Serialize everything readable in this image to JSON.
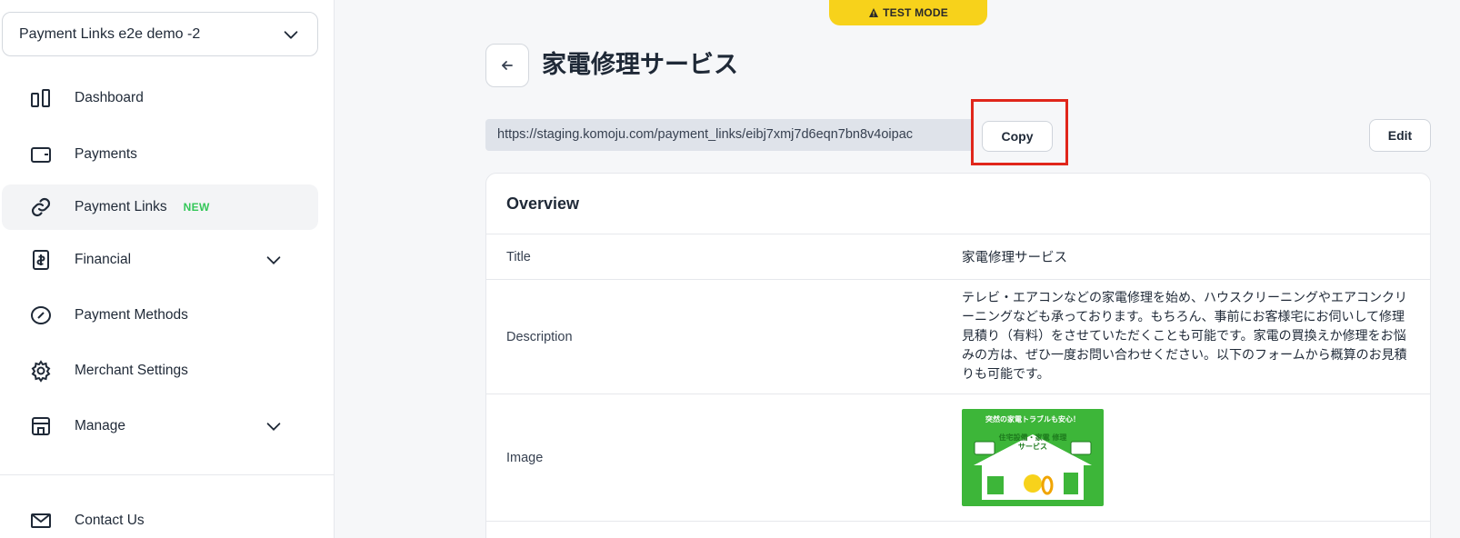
{
  "sidebar": {
    "account": "Payment Links e2e demo -2",
    "items": [
      {
        "label": "Dashboard"
      },
      {
        "label": "Payments"
      },
      {
        "label": "Payment Links",
        "badge": "NEW"
      },
      {
        "label": "Financial"
      },
      {
        "label": "Payment Methods"
      },
      {
        "label": "Merchant Settings"
      },
      {
        "label": "Manage"
      },
      {
        "label": "Contact Us"
      }
    ]
  },
  "banner": {
    "text": "TEST MODE"
  },
  "header": {
    "title": "家電修理サービス",
    "url": "https://staging.komoju.com/payment_links/eibj7xmj7d6eqn7bn8v4oipac",
    "copy_label": "Copy",
    "edit_label": "Edit"
  },
  "overview": {
    "heading": "Overview",
    "rows": [
      {
        "key": "Title",
        "value": "家電修理サービス"
      },
      {
        "key": "Description",
        "value": "テレビ・エアコンなどの家電修理を始め、ハウスクリーニングやエアコンクリーニングなども承っております。もちろん、事前にお客様宅にお伺いして修理見積り（有料）をさせていただくことも可能です。家電の買換えか修理をお悩みの方は、ぜひ一度お問い合わせください。以下のフォームから概算のお見積りも可能です。"
      },
      {
        "key": "Image",
        "value": ""
      }
    ]
  },
  "image": {
    "banner_text": "突然の家電トラブルも安心！",
    "caption": "住宅設備・家電 修理サービス"
  },
  "colors": {
    "accent_green": "#34c759",
    "test_yellow": "#f7d21b",
    "highlight_red": "#e0261b"
  }
}
